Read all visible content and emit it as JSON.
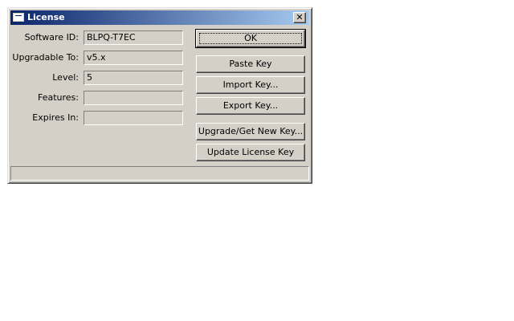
{
  "window": {
    "title": "License",
    "close_label": "✕"
  },
  "fields": [
    {
      "label": "Software ID:",
      "value": "BLPQ-T7EC"
    },
    {
      "label": "Upgradable To:",
      "value": "v5.x"
    },
    {
      "label": "Level:",
      "value": "5"
    },
    {
      "label": "Features:",
      "value": ""
    },
    {
      "label": "Expires In:",
      "value": ""
    }
  ],
  "buttons": {
    "ok": "OK",
    "paste_key": "Paste Key",
    "import_key": "Import Key...",
    "export_key": "Export Key...",
    "upgrade_key": "Upgrade/Get New Key...",
    "update_license": "Update License Key"
  },
  "status": {
    "text": ""
  }
}
